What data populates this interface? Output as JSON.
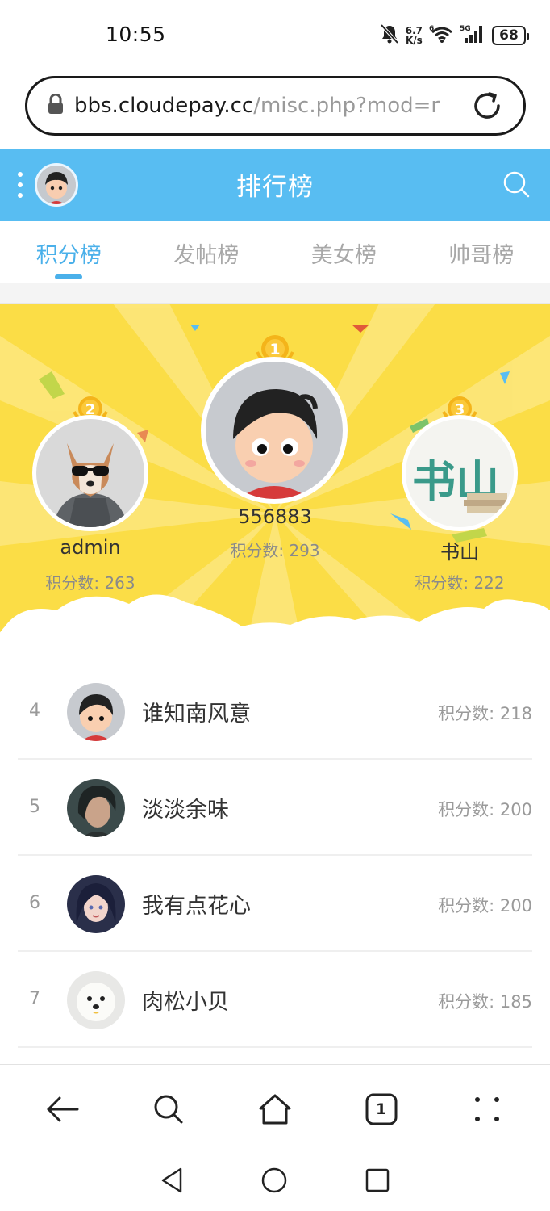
{
  "status_bar": {
    "time": "10:55",
    "net_speed_value": "6.7",
    "net_speed_unit": "K/s",
    "battery": "68"
  },
  "browser": {
    "url_domain": "bbs.cloudepay.cc",
    "url_path": "/misc.php?mod=r",
    "tab_count": "1"
  },
  "header": {
    "title": "排行榜"
  },
  "tabs": [
    {
      "label": "积分榜",
      "active": true
    },
    {
      "label": "发帖榜",
      "active": false
    },
    {
      "label": "美女榜",
      "active": false
    },
    {
      "label": "帅哥榜",
      "active": false
    }
  ],
  "podium": {
    "first": {
      "medal": "1",
      "name": "556883",
      "score": "积分数: 293"
    },
    "second": {
      "medal": "2",
      "name": "admin",
      "score": "积分数: 263"
    },
    "third": {
      "medal": "3",
      "name": "书山",
      "score": "积分数: 222",
      "avatar_text": "书山"
    }
  },
  "ranking": [
    {
      "rank": "4",
      "name": "谁知南风意",
      "score": "积分数: 218"
    },
    {
      "rank": "5",
      "name": "淡淡余味",
      "score": "积分数: 200"
    },
    {
      "rank": "6",
      "name": "我有点花心",
      "score": "积分数: 200"
    },
    {
      "rank": "7",
      "name": "肉松小贝",
      "score": "积分数: 185"
    }
  ],
  "colors": {
    "header_blue": "#58bdf2",
    "active_tab": "#4ab0ea",
    "podium_yellow": "#fbdd46",
    "medal_gold": "#f4b41a"
  },
  "icons": {
    "status": [
      "mute-bell-icon",
      "wifi-icon",
      "signal-icon",
      "battery-icon"
    ],
    "url_bar": [
      "lock-icon",
      "reload-icon"
    ],
    "header": [
      "menu-dots-icon",
      "search-icon"
    ],
    "browser_bar": [
      "back-arrow-icon",
      "search-icon",
      "home-icon",
      "tabs-icon",
      "more-icon"
    ],
    "nav": [
      "nav-back-icon",
      "nav-home-icon",
      "nav-recents-icon"
    ]
  }
}
